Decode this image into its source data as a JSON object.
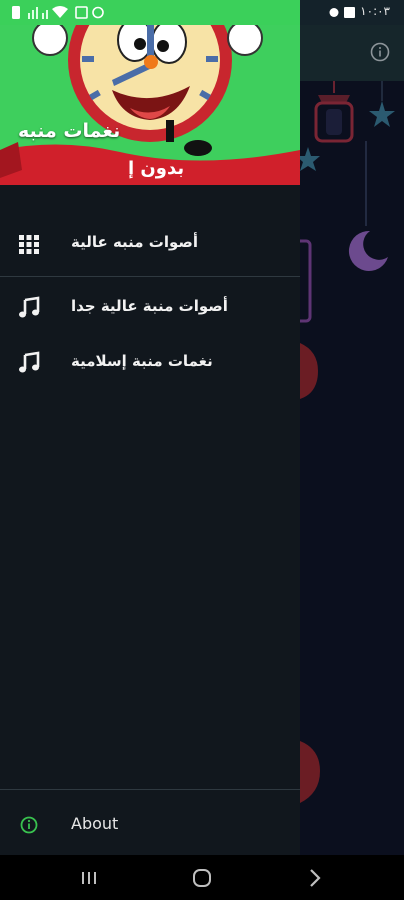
{
  "status_bar": {
    "clock": "١٠:٠٣",
    "icons": [
      "image-icon",
      "alarm-icon",
      "wifi-icon",
      "signal-icon",
      "battery-icon"
    ]
  },
  "app": {
    "toolbar_icon": "info-icon"
  },
  "drawer": {
    "header": {
      "title": "نغمات منبه",
      "banner_text": "بدون إ"
    },
    "items": [
      {
        "label": "أصوات منبه عالية",
        "icon": "grid-icon"
      },
      {
        "label": "أصوات منبة عالية جدا",
        "icon": "music-note-icon"
      },
      {
        "label": "نغمات منبة إسلامية",
        "icon": "music-note-icon"
      }
    ],
    "footer": {
      "label": "About",
      "icon": "info-icon"
    }
  },
  "nav_bar": {
    "buttons": [
      "recents-button",
      "home-button",
      "back-button"
    ]
  },
  "colors": {
    "header_green": "#3ecf5d",
    "drawer_bg": "#11171d",
    "about_icon": "#39c24f"
  }
}
